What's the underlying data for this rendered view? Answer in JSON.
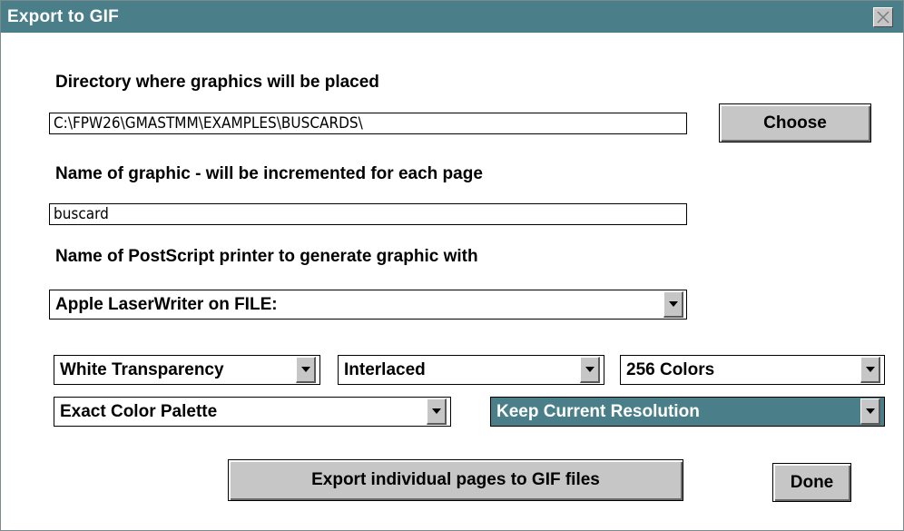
{
  "window": {
    "title": "Export to GIF"
  },
  "directory": {
    "label": "Directory where graphics will be placed",
    "value": "C:\\FPW26\\GMASTMM\\EXAMPLES\\BUSCARDS\\",
    "choose_label": "Choose"
  },
  "graphic_name": {
    "label": "Name of graphic - will be incremented for each page",
    "value": "buscard"
  },
  "printer": {
    "label": "Name of PostScript printer to generate graphic with",
    "selected": "Apple LaserWriter on FILE:"
  },
  "options": {
    "transparency": "White Transparency",
    "interlace": "Interlaced",
    "colors": "256 Colors",
    "palette": "Exact Color Palette",
    "resolution": "Keep Current Resolution"
  },
  "actions": {
    "export_label": "Export individual pages to GIF files",
    "done_label": "Done"
  },
  "colors": {
    "titlebar": "#4a7f8a",
    "button_face": "#c6c6c6"
  }
}
